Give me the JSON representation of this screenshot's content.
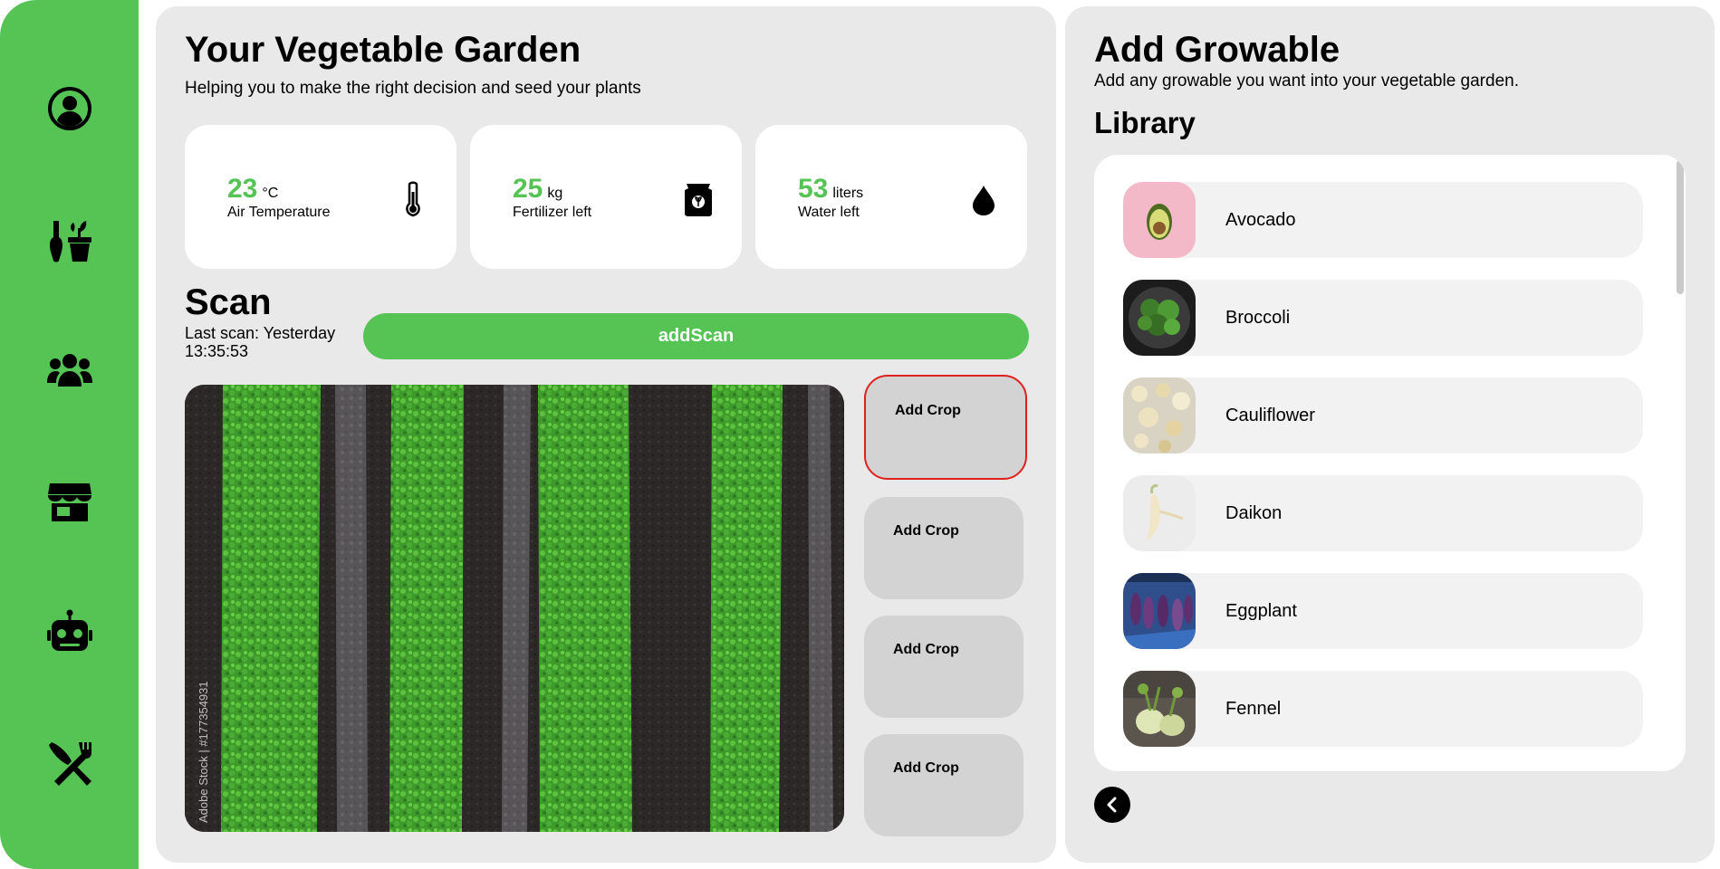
{
  "sidebar": {
    "items": [
      {
        "icon": "user-circle-icon",
        "name": "sidebar-item-profile"
      },
      {
        "icon": "garden-tools-icon",
        "name": "sidebar-item-garden"
      },
      {
        "icon": "people-group-icon",
        "name": "sidebar-item-community"
      },
      {
        "icon": "store-icon",
        "name": "sidebar-item-store"
      },
      {
        "icon": "robot-icon",
        "name": "sidebar-item-assistant"
      },
      {
        "icon": "utensils-icon",
        "name": "sidebar-item-recipes"
      }
    ]
  },
  "garden": {
    "title": "Your Vegetable Garden",
    "subtitle": "Helping you to make the right decision and seed your plants"
  },
  "stats": [
    {
      "value": "23",
      "unit": "°C",
      "label": "Air Temperature",
      "icon": "thermometer-icon"
    },
    {
      "value": "25",
      "unit": "kg",
      "label": "Fertilizer left",
      "icon": "fertilizer-bag-icon"
    },
    {
      "value": "53",
      "unit": "liters",
      "label": "Water left",
      "icon": "water-drop-icon"
    }
  ],
  "scan": {
    "title": "Scan",
    "last_scan": "Last scan: Yesterday 13:35:53",
    "add_button": "addScan",
    "image_watermark": "Adobe Stock | #177354931"
  },
  "crop_slots": [
    {
      "label": "Add Crop",
      "active": true
    },
    {
      "label": "Add Crop",
      "active": false
    },
    {
      "label": "Add Crop",
      "active": false
    },
    {
      "label": "Add Crop",
      "active": false
    }
  ],
  "growable": {
    "title": "Add Growable",
    "subtitle": "Add any growable you want into your vegetable garden.",
    "library_title": "Library",
    "items": [
      {
        "name": "Avocado"
      },
      {
        "name": "Broccoli"
      },
      {
        "name": "Cauliflower"
      },
      {
        "name": "Daikon"
      },
      {
        "name": "Eggplant"
      },
      {
        "name": "Fennel"
      }
    ]
  },
  "colors": {
    "accent": "#55c455",
    "panel": "#e9e9e9",
    "active_border": "#e0201c"
  }
}
